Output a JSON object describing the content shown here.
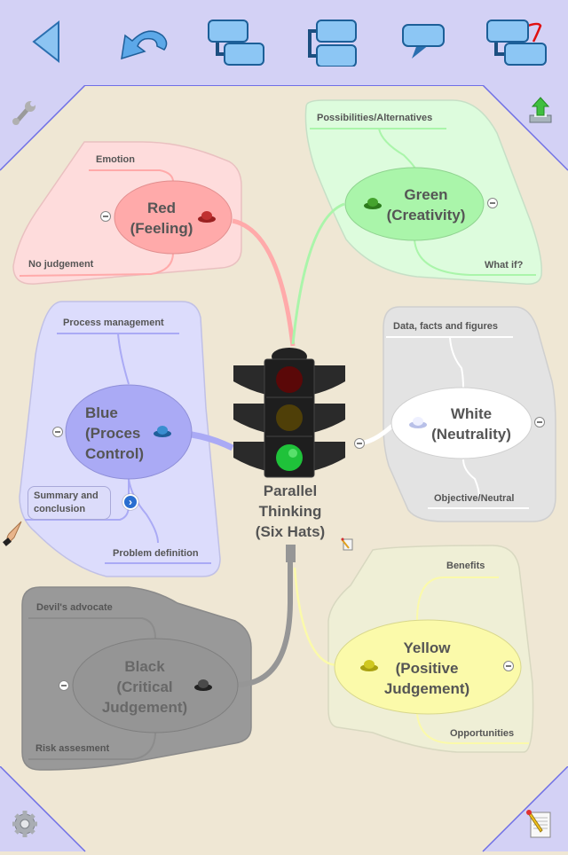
{
  "toolbar": {
    "buttons": [
      {
        "name": "back-button",
        "icon": "back-triangle-icon"
      },
      {
        "name": "undo-button",
        "icon": "undo-arrow-icon"
      },
      {
        "name": "add-subtopic-button",
        "icon": "subtopic-icon"
      },
      {
        "name": "add-sibling-topic-button",
        "icon": "sibling-topic-icon"
      },
      {
        "name": "add-callout-button",
        "icon": "callout-icon"
      },
      {
        "name": "add-relationship-button",
        "icon": "relationship-icon"
      }
    ]
  },
  "corners": {
    "top_left": {
      "icon": "wrench-icon"
    },
    "top_right": {
      "icon": "export-upload-icon"
    },
    "bottom_left": {
      "icon": "gear-icon"
    },
    "bottom_right": {
      "icon": "notepad-icon"
    }
  },
  "colors": {
    "toolbar_bg": "#d3d1f5",
    "canvas_bg": "#efe7d4",
    "accent_line": "#6f6fe6",
    "red": "#ffaaaa",
    "green": "#aaf5aa",
    "blue": "#aaaaf5",
    "white": "#ffffff",
    "black": "#959595",
    "yellow": "#fbfaaa"
  },
  "central_topic": {
    "label": "Parallel\nThinking\n(Six Hats)",
    "icon": "traffic-light-icon",
    "note_icon": "note-icon"
  },
  "branches": {
    "red": {
      "label": "Red\n(Feeling)",
      "hat": "red-hat-icon",
      "children": [
        "Emotion",
        "No judgement"
      ]
    },
    "green": {
      "label": "Green\n(Creativity)",
      "hat": "green-hat-icon",
      "children": [
        "Possibilities/Alternatives",
        "What if?"
      ]
    },
    "blue": {
      "label": "Blue\n(Proces\nControl)",
      "hat": "blue-hat-icon",
      "children": [
        "Process management",
        "Summary and conclusion",
        "Problem definition"
      ]
    },
    "white": {
      "label": "White\n(Neutrality)",
      "hat": "white-hat-icon",
      "children": [
        "Data, facts and figures",
        "Objective/Neutral"
      ]
    },
    "black": {
      "label": "Black\n(Critical\nJudgement)",
      "hat": "black-hat-icon",
      "children": [
        "Devil's advocate",
        "Risk assesment"
      ]
    },
    "yellow": {
      "label": "Yellow\n(Positive\nJudgement)",
      "hat": "yellow-hat-icon",
      "children": [
        "Benefits",
        "Opportunities"
      ]
    }
  },
  "summary_expand_icon": "chevron-right-icon",
  "drag_handle_icon": "pointing-hand-icon"
}
